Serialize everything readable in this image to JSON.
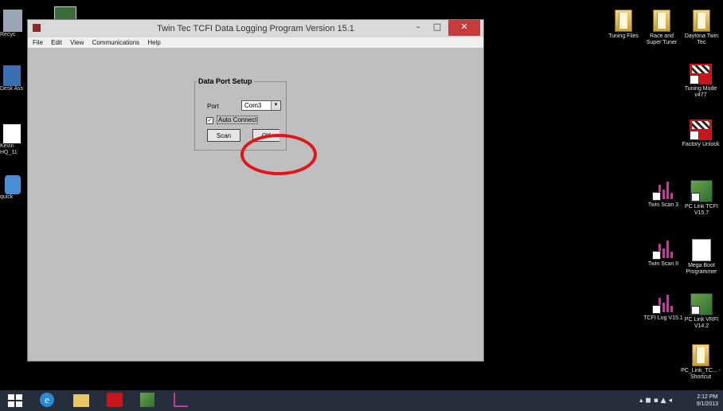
{
  "window": {
    "title": "Twin Tec TCFI Data Logging Program Version 15.1",
    "controls": {
      "minimize": "–",
      "maximize": "□",
      "close": "✕"
    },
    "menu": [
      "File",
      "Edit",
      "View",
      "Communications",
      "Help"
    ]
  },
  "dialog": {
    "legend": "Data Port Setup",
    "port_label": "Port",
    "port_value": "Com3",
    "auto_connect_label": "Auto Connect",
    "auto_connect_checked": true,
    "scan_label": "Scan",
    "ok_label": "OK"
  },
  "left_icons": [
    "Recyc",
    "Desk Ass",
    "Kevin HQ_11",
    "quick"
  ],
  "desktop_icons": [
    {
      "label": "Tuning Files",
      "icon": "folder-icon"
    },
    {
      "label": "Race and Super Tuner",
      "icon": "folder-icon"
    },
    {
      "label": "Daytona Twin Tec",
      "icon": "folder-icon"
    },
    {
      "label": "Tuning Mode v477",
      "icon": "checkered-flag-icon"
    },
    {
      "label": "Factory Unlock",
      "icon": "checkered-flag-icon"
    },
    {
      "label": "Twin Scan 3",
      "icon": "chart-icon"
    },
    {
      "label": "PC Link TCFI V15.7",
      "icon": "green-app-icon"
    },
    {
      "label": "Twin Scan II",
      "icon": "chart-icon"
    },
    {
      "label": "Mega Boot Programmer",
      "icon": "document-icon"
    },
    {
      "label": "TCFI Log V15.1",
      "icon": "chart-icon"
    },
    {
      "label": "PC Link VRFI V14.2",
      "icon": "green-app-icon"
    },
    {
      "label": "PC_Link_TC... - Shortcut",
      "icon": "folder-icon"
    }
  ],
  "taskbar": {
    "clock_time": "2:12 PM",
    "clock_date": "9/1/2013"
  },
  "colors": {
    "annotation_ring": "#e0161c",
    "close_button": "#c63c3c",
    "taskbar": "#262e3d"
  }
}
